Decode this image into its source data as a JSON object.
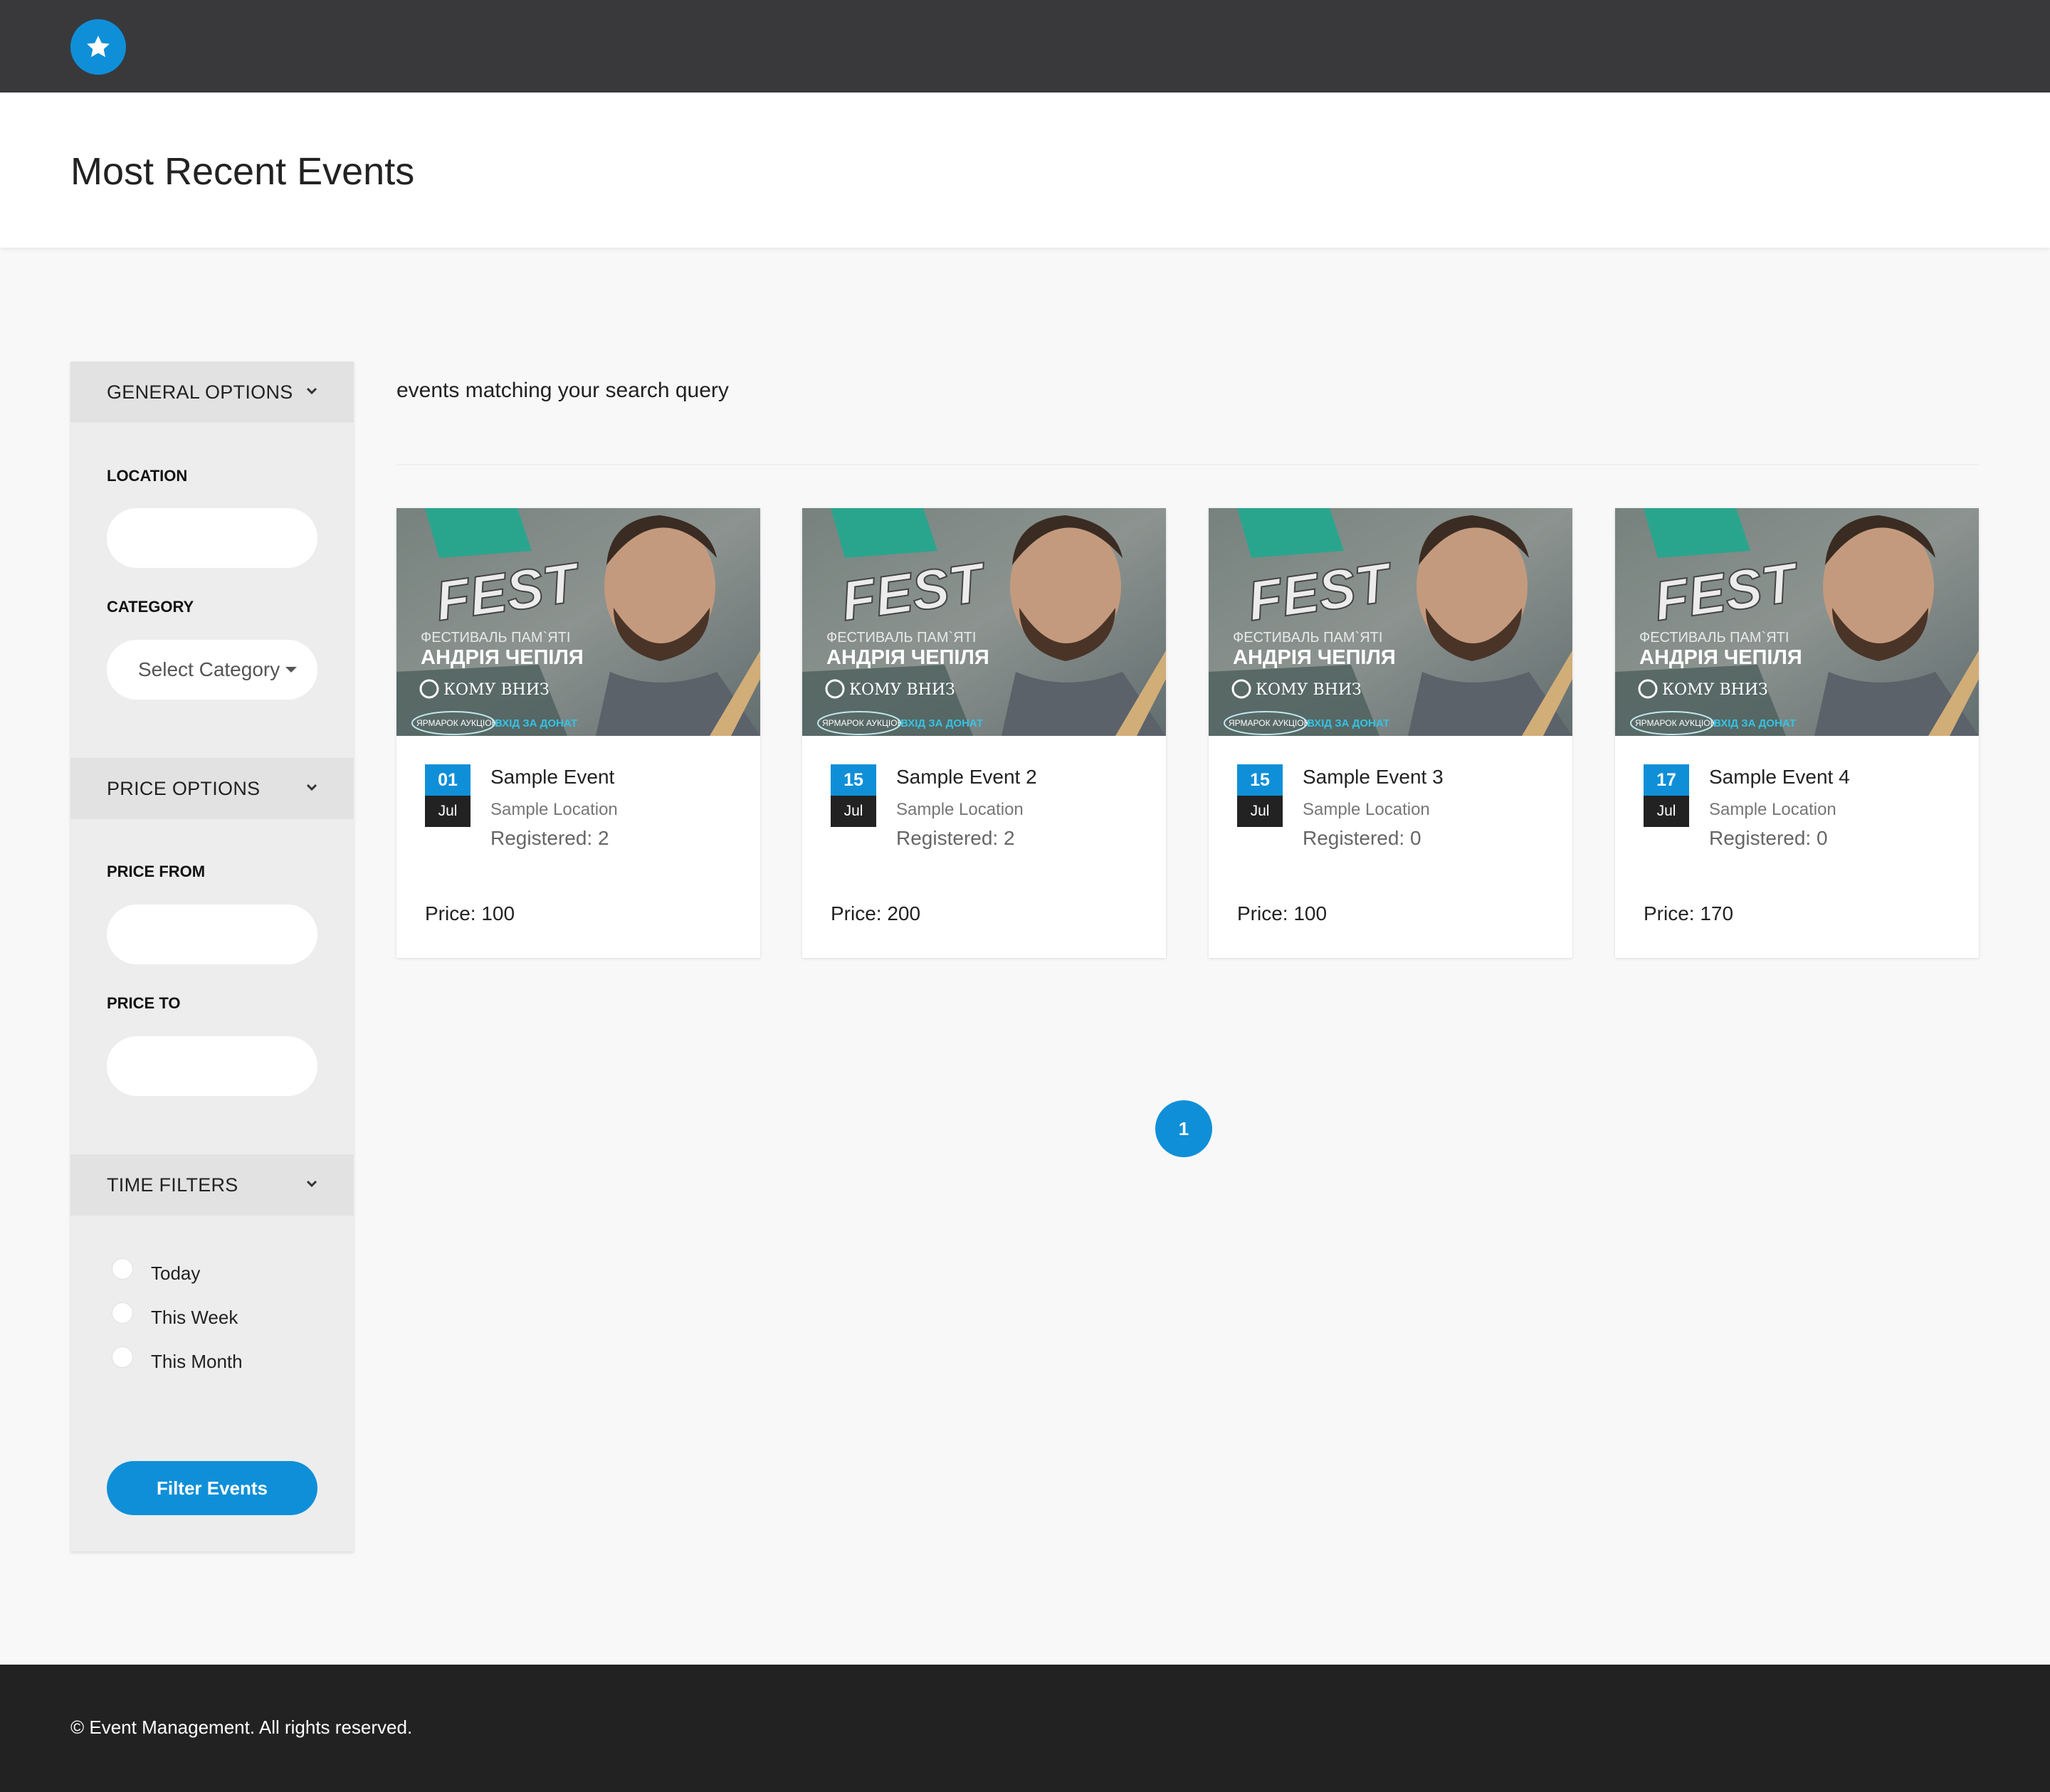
{
  "header": {
    "logo_icon": "star-icon",
    "page_title": "Most Recent Events"
  },
  "sidebar": {
    "general_options": {
      "label": "GENERAL OPTIONS",
      "location_label": "LOCATION",
      "location_value": "",
      "category_label": "CATEGORY",
      "category_selected": "Select Category"
    },
    "price_options": {
      "label": "PRICE OPTIONS",
      "price_from_label": "PRICE FROM",
      "price_from_value": "",
      "price_to_label": "PRICE TO",
      "price_to_value": ""
    },
    "time_filters": {
      "label": "TIME FILTERS",
      "options": [
        "Today",
        "This Week",
        "This Month"
      ]
    },
    "filter_button": "Filter Events"
  },
  "results": {
    "summary": "events matching your search query"
  },
  "events": [
    {
      "day": "01",
      "month": "Jul",
      "title": "Sample Event",
      "location": "Sample Location",
      "registered": "Registered: 2",
      "price": "Price: 100"
    },
    {
      "day": "15",
      "month": "Jul",
      "title": "Sample Event 2",
      "location": "Sample Location",
      "registered": "Registered: 2",
      "price": "Price: 200"
    },
    {
      "day": "15",
      "month": "Jul",
      "title": "Sample Event 3",
      "location": "Sample Location",
      "registered": "Registered: 0",
      "price": "Price: 100"
    },
    {
      "day": "17",
      "month": "Jul",
      "title": "Sample Event 4",
      "location": "Sample Location",
      "registered": "Registered: 0",
      "price": "Price: 170"
    }
  ],
  "event_image_text": {
    "fest": "FEST",
    "line1": "ФЕСТИВАЛЬ ПАМ`ЯТІ",
    "line2": "АНДРІЯ ЧЕПІЛЯ",
    "line3": "КОМУ ВНИЗ",
    "badge": "ЯРМАРОК АУКЦІОН",
    "entry": "ВХІД ЗА ДОНАТ"
  },
  "pagination": {
    "current": "1"
  },
  "footer": {
    "text": "© Event Management. All rights reserved."
  },
  "colors": {
    "accent": "#0f8fd8",
    "topbar": "#39393b",
    "footer": "#222222"
  }
}
